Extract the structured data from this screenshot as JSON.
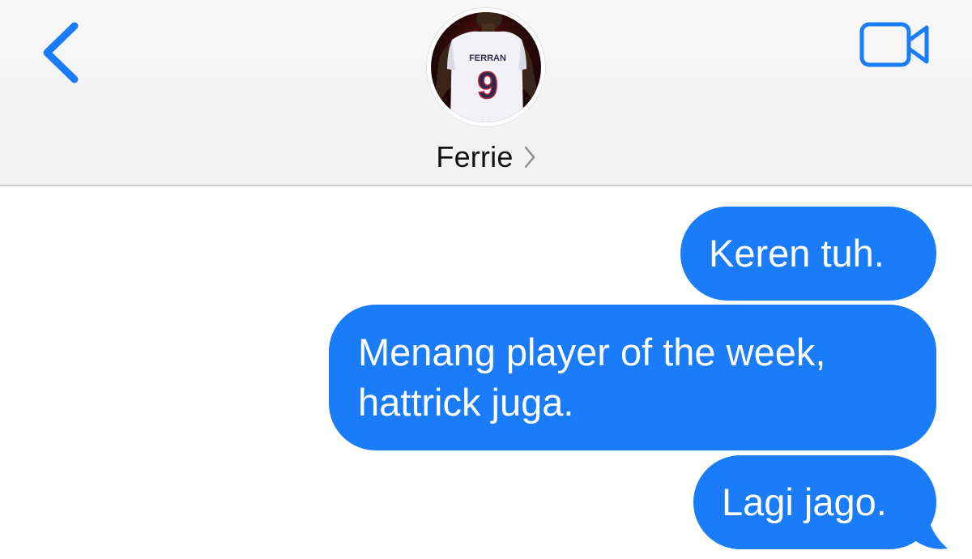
{
  "header": {
    "back_icon": "chevron-left-icon",
    "video_icon": "video-camera-icon",
    "contact_name": "Ferrie",
    "avatar_jersey_name": "FERRAN",
    "avatar_jersey_number": "9",
    "accent_color": "#1a7cf8"
  },
  "messages": [
    {
      "text": "Keren tuh.",
      "direction": "outgoing"
    },
    {
      "text": "Menang player of the week,\nhattrick juga.",
      "direction": "outgoing"
    },
    {
      "text": "Lagi jago.",
      "direction": "outgoing"
    }
  ]
}
